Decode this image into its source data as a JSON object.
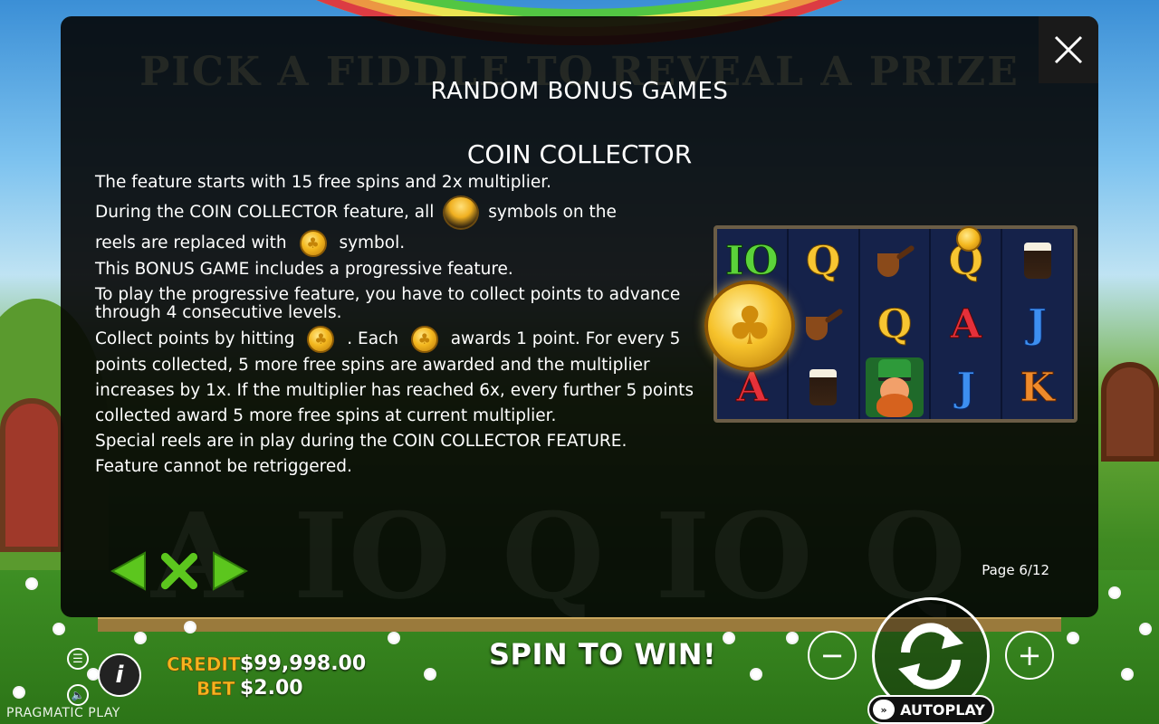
{
  "background": {
    "ghost_title": "PICK A FIDDLE TO REVEAL A PRIZE",
    "ghost_symbols": [
      "A",
      "IO",
      "Q",
      "IO",
      "Q"
    ]
  },
  "modal": {
    "page_title": "RANDOM BONUS GAMES",
    "section_title": "COIN COLLECTOR",
    "paragraphs": {
      "p1": "The feature starts with 15 free spins and 2x multiplier.",
      "p2_a": "During the COIN COLLECTOR feature, all",
      "p2_b": "symbols on the",
      "p2_c": "reels are replaced with",
      "p2_d": "symbol.",
      "p3": "This BONUS GAME includes a progressive feature.",
      "p4": "To play the progressive feature, you have to collect points to advance through 4 consecutive levels.",
      "p5_a": "Collect points by hitting",
      "p5_b": ". Each",
      "p5_c": "awards 1 point. For every 5",
      "p5_d": "points collected, 5 more free spins are awarded and the multiplier increases by 1x. If the multiplier has reached 6x, every further 5 points collected award 5 more free spins at current multiplier.",
      "p6": "Special reels are in play during the COIN COLLECTOR FEATURE.",
      "p7": "Feature cannot be retriggered."
    },
    "reels": [
      [
        "IO",
        "Q",
        "pipe",
        "Q",
        "beer"
      ],
      [
        "coin",
        "pipe",
        "Q",
        "A",
        "J"
      ],
      [
        "A",
        "beer",
        "leprechaun",
        "J",
        "K"
      ]
    ],
    "page_indicator": "Page 6/12",
    "icons": {
      "close": "close-icon",
      "prev": "arrow-left-icon",
      "exit": "x-icon",
      "next": "arrow-right-icon"
    },
    "colors": {
      "nav_green": "#5cc61e",
      "overlay": "#040404"
    }
  },
  "footer": {
    "credit_label": "CREDIT",
    "credit_value": "$99,998.00",
    "bet_label": "BET",
    "bet_value": "$2.00",
    "message": "SPIN TO WIN!",
    "autoplay_label": "AUTOPLAY",
    "brand": "PRAGMATIC PLAY",
    "minus_label": "−",
    "plus_label": "+",
    "info_label": "i",
    "colors": {
      "label_gold": "#f6b41e"
    }
  }
}
